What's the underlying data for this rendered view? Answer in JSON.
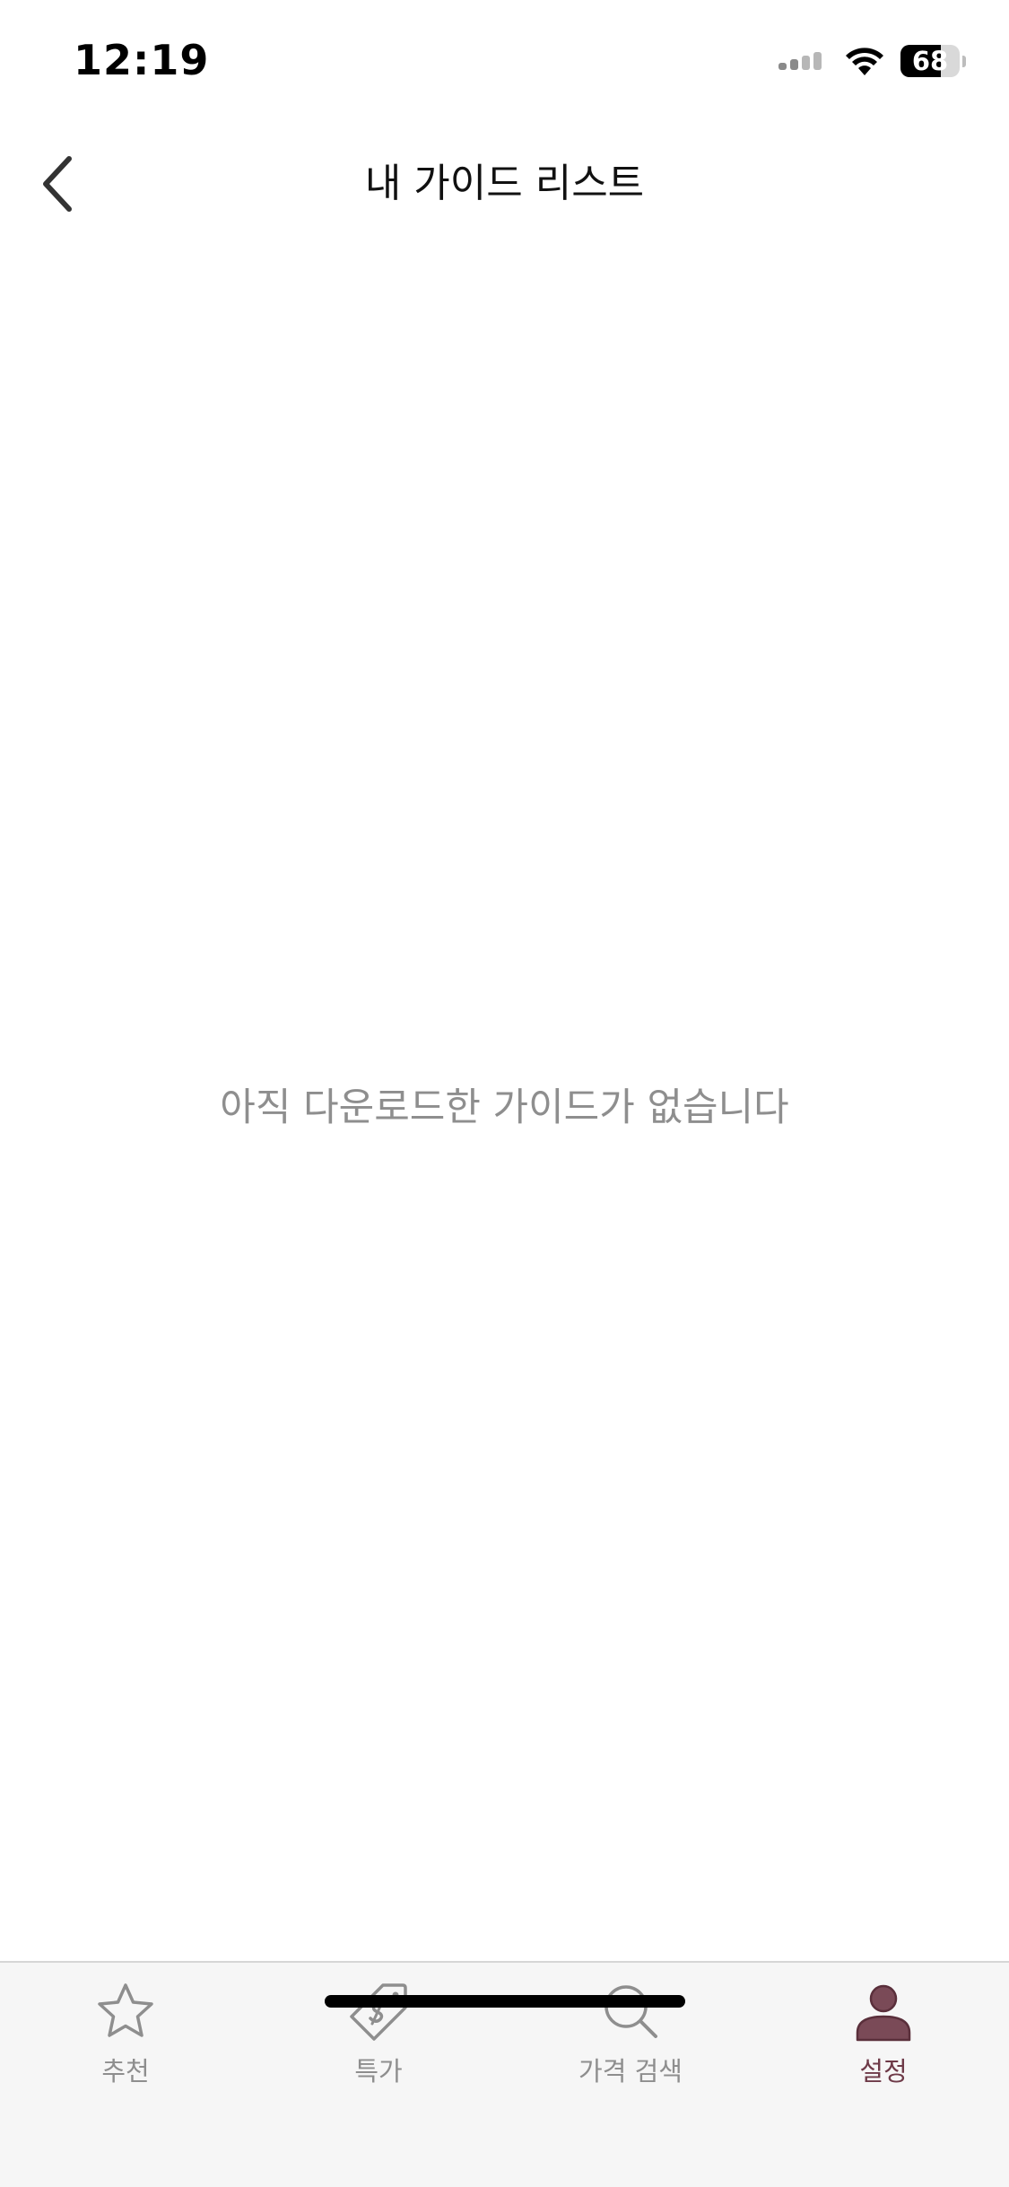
{
  "status_bar": {
    "time": "12:19",
    "battery_level": "68",
    "battery_fraction": 0.68,
    "signal_bars_active": 2,
    "signal_bars_total": 4
  },
  "nav": {
    "title": "내 가이드 리스트",
    "back_icon": "chevron-left-icon"
  },
  "empty_state": {
    "message": "아직 다운로드한 가이드가 없습니다"
  },
  "tab_bar": {
    "items": [
      {
        "label": "추천",
        "icon": "star-icon",
        "active": false
      },
      {
        "label": "특가",
        "icon": "price-tag-icon",
        "active": false
      },
      {
        "label": "가격 검색",
        "icon": "search-icon",
        "active": false
      },
      {
        "label": "설정",
        "icon": "person-icon",
        "active": true
      }
    ],
    "inactive_color": "#8e8e8e",
    "active_color": "#6e3a48"
  }
}
